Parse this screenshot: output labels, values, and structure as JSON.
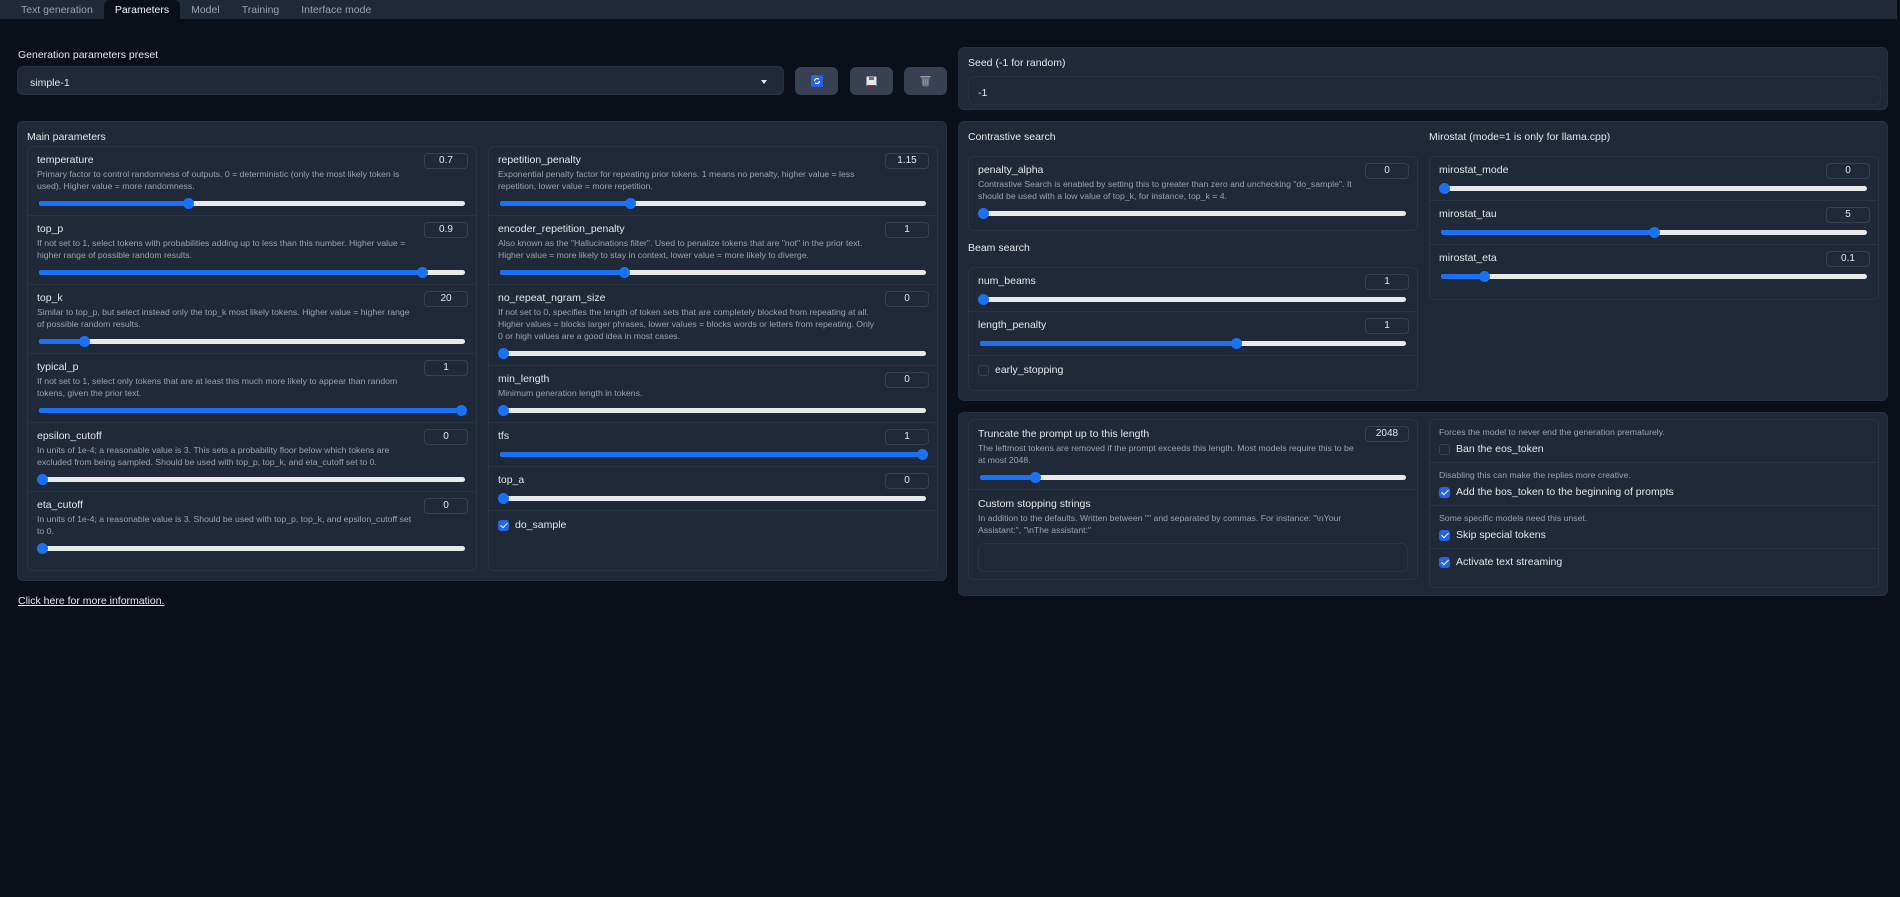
{
  "tabs": [
    {
      "label": "Text generation",
      "active": false
    },
    {
      "label": "Parameters",
      "active": true
    },
    {
      "label": "Model",
      "active": false
    },
    {
      "label": "Training",
      "active": false
    },
    {
      "label": "Interface mode",
      "active": false
    }
  ],
  "preset": {
    "label": "Generation parameters preset",
    "value": "simple-1",
    "buttons": [
      {
        "icon": "refresh-icon",
        "action": "refresh"
      },
      {
        "icon": "save-icon",
        "action": "save"
      },
      {
        "icon": "trash-icon",
        "action": "delete"
      }
    ]
  },
  "seed": {
    "label": "Seed (-1 for random)",
    "value": "-1"
  },
  "main": {
    "title": "Main parameters",
    "left": [
      {
        "name": "temperature",
        "value": "0.7",
        "fraction": 0.35,
        "info": "Primary factor to control randomness of outputs. 0 = deterministic (only the most likely token is used). Higher value = more randomness."
      },
      {
        "name": "top_p",
        "value": "0.9",
        "fraction": 0.9,
        "info": "If not set to 1, select tokens with probabilities adding up to less than this number. Higher value = higher range of possible random results."
      },
      {
        "name": "top_k",
        "value": "20",
        "fraction": 0.105,
        "info": "Similar to top_p, but select instead only the top_k most likely tokens. Higher value = higher range of possible random results."
      },
      {
        "name": "typical_p",
        "value": "1",
        "fraction": 1.0,
        "info": "If not set to 1, select only tokens that are at least this much more likely to appear than random tokens, given the prior text."
      },
      {
        "name": "epsilon_cutoff",
        "value": "0",
        "fraction": 0.0,
        "info": "In units of 1e-4; a reasonable value is 3. This sets a probability floor below which tokens are excluded from being sampled. Should be used with top_p, top_k, and eta_cutoff set to 0."
      },
      {
        "name": "eta_cutoff",
        "value": "0",
        "fraction": 0.0,
        "info": "In units of 1e-4; a reasonable value is 3. Should be used with top_p, top_k, and epsilon_cutoff set to 0."
      }
    ],
    "right": [
      {
        "name": "repetition_penalty",
        "value": "1.15",
        "fraction": 0.305,
        "info": "Exponential penalty factor for repeating prior tokens. 1 means no penalty, higher value = less repetition, lower value = more repetition."
      },
      {
        "name": "encoder_repetition_penalty",
        "value": "1",
        "fraction": 0.29,
        "info": "Also known as the \"Hallucinations filter\". Used to penalize tokens that are \"not\" in the prior text. Higher value = more likely to stay in context, lower value = more likely to diverge."
      },
      {
        "name": "no_repeat_ngram_size",
        "value": "0",
        "fraction": 0.0,
        "info": "If not set to 0, specifies the length of token sets that are completely blocked from repeating at all. Higher values = blocks larger phrases, lower values = blocks words or letters from repeating. Only 0 or high values are a good idea in most cases."
      },
      {
        "name": "min_length",
        "value": "0",
        "fraction": 0.0,
        "info": "Minimum generation length in tokens."
      },
      {
        "name": "tfs",
        "value": "1",
        "fraction": 1.0,
        "info": ""
      },
      {
        "name": "top_a",
        "value": "0",
        "fraction": 0.0,
        "info": ""
      }
    ],
    "do_sample": {
      "label": "do_sample",
      "checked": true
    }
  },
  "contrastive": {
    "title": "Contrastive search",
    "params": [
      {
        "name": "penalty_alpha",
        "value": "0",
        "fraction": 0.0,
        "info": "Contrastive Search is enabled by setting this to greater than zero and unchecking \"do_sample\". It should be used with a low value of top_k, for instance, top_k = 4."
      }
    ]
  },
  "beam": {
    "title": "Beam search",
    "params": [
      {
        "name": "num_beams",
        "value": "1",
        "fraction": 0.0,
        "info": ""
      },
      {
        "name": "length_penalty",
        "value": "1",
        "fraction": 0.6,
        "info": ""
      }
    ],
    "early_stopping": {
      "label": "early_stopping",
      "checked": false
    }
  },
  "mirostat": {
    "title": "Mirostat (mode=1 is only for llama.cpp)",
    "params": [
      {
        "name": "mirostat_mode",
        "value": "0",
        "fraction": 0.0,
        "info": ""
      },
      {
        "name": "mirostat_tau",
        "value": "5",
        "fraction": 0.5,
        "info": ""
      },
      {
        "name": "mirostat_eta",
        "value": "0.1",
        "fraction": 0.1,
        "info": ""
      }
    ]
  },
  "truncate": {
    "name": "Truncate the prompt up to this length",
    "value": "2048",
    "fraction": 0.13,
    "info": "The leftmost tokens are removed if the prompt exceeds this length. Most models require this to be at most 2048."
  },
  "stopping": {
    "name": "Custom stopping strings",
    "info": "In addition to the defaults. Written between \"\" and separated by commas. For instance: \"\\nYour Assistant:\", \"\\nThe assistant:\"",
    "value": ""
  },
  "flags": [
    {
      "info": "Forces the model to never end the generation prematurely.",
      "label": "Ban the eos_token",
      "checked": false
    },
    {
      "info": "Disabling this can make the replies more creative.",
      "label": "Add the bos_token to the beginning of prompts",
      "checked": true
    },
    {
      "info": "Some specific models need this unset.",
      "label": "Skip special tokens",
      "checked": true
    },
    {
      "info": "",
      "label": "Activate text streaming",
      "checked": true
    }
  ],
  "more_info_link": "Click here for more information.",
  "colors": {
    "accent": "#1972f5",
    "panel": "#1f2937",
    "background": "#0b0f19"
  }
}
